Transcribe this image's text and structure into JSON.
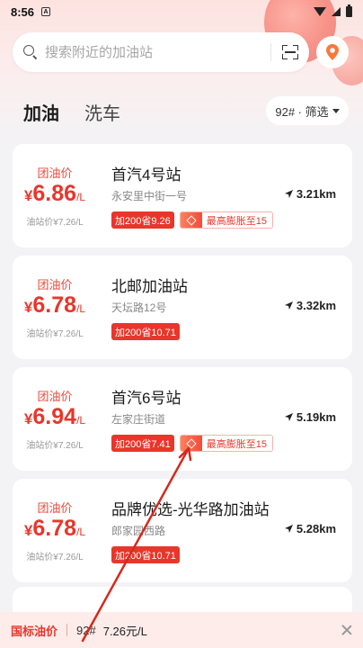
{
  "status_bar": {
    "time": "8:56"
  },
  "search": {
    "placeholder": "搜索附近的加油站"
  },
  "tabs": [
    {
      "label": "加油",
      "active": true
    },
    {
      "label": "洗车",
      "active": false
    }
  ],
  "filter": {
    "label": "92# · 筛选"
  },
  "stations": [
    {
      "group_label": "团油价",
      "price_currency": "¥",
      "price": "6.86",
      "unit": "/L",
      "orig_price": "油站价¥7.26/L",
      "name": "首汽4号站",
      "address": "永安里中街一号",
      "distance": "3.21km",
      "save_tag": "加200省9.26",
      "boost_tag": "最高膨胀至15"
    },
    {
      "group_label": "团油价",
      "price_currency": "¥",
      "price": "6.78",
      "unit": "/L",
      "orig_price": "油站价¥7.26/L",
      "name": "北邮加油站",
      "address": "天坛路12号",
      "distance": "3.32km",
      "save_tag": "加200省10.71",
      "boost_tag": null
    },
    {
      "group_label": "团油价",
      "price_currency": "¥",
      "price": "6.94",
      "unit": "/L",
      "orig_price": "油站价¥7.26/L",
      "name": "首汽6号站",
      "address": "左家庄街道",
      "distance": "5.19km",
      "save_tag": "加200省7.41",
      "boost_tag": "最高膨胀至15"
    },
    {
      "group_label": "团油价",
      "price_currency": "¥",
      "price": "6.78",
      "unit": "/L",
      "orig_price": "油站价¥7.26/L",
      "name": "品牌优选-光华路加油站",
      "address": "郎家园西路",
      "distance": "5.28km",
      "save_tag": "加200省10.71",
      "boost_tag": null
    }
  ],
  "bottom_bar": {
    "label": "国标油价",
    "grade": "92#",
    "value": "7.26元/L"
  },
  "colors": {
    "accent": "#e8362a",
    "annotation_arrow": "#d42a1e"
  }
}
